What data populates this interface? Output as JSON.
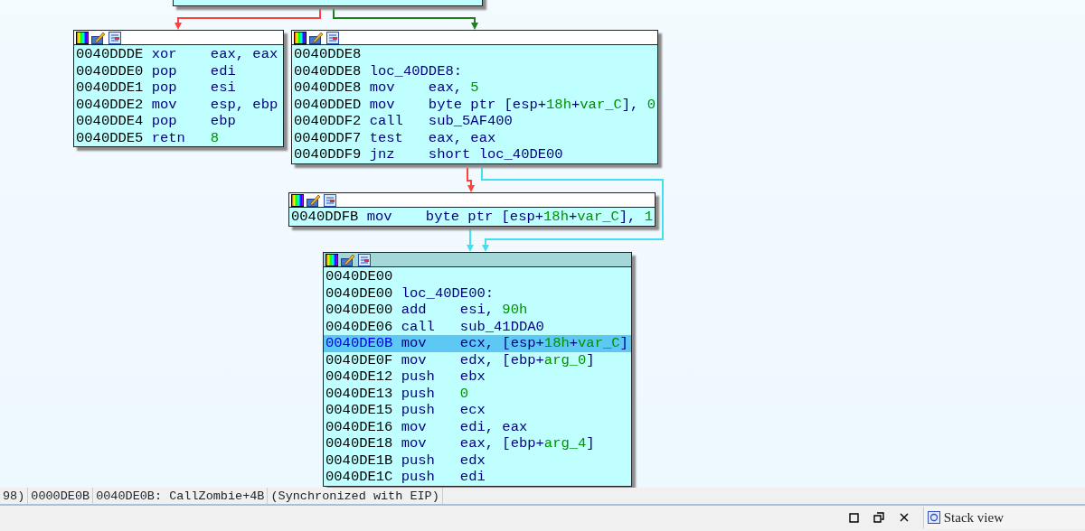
{
  "graph": {
    "edges": [
      {
        "color": "#ff4040"
      },
      {
        "color": "#208020"
      },
      {
        "color": "#ff4040"
      },
      {
        "color": "#40e0f0"
      },
      {
        "color": "#40e0f0"
      }
    ],
    "nodes": [
      {
        "selected": false,
        "lines": [
          {
            "address": "0040DDDE",
            "mnemonic": "xor",
            "operand": [
              {
                "text": "eax, eax",
                "kind": "plain"
              }
            ],
            "selected": false
          },
          {
            "address": "0040DDE0",
            "mnemonic": "pop",
            "operand": [
              {
                "text": "edi",
                "kind": "plain"
              }
            ],
            "selected": false
          },
          {
            "address": "0040DDE1",
            "mnemonic": "pop",
            "operand": [
              {
                "text": "esi",
                "kind": "plain"
              }
            ],
            "selected": false
          },
          {
            "address": "0040DDE2",
            "mnemonic": "mov",
            "operand": [
              {
                "text": "esp, ebp",
                "kind": "plain"
              }
            ],
            "selected": false
          },
          {
            "address": "0040DDE4",
            "mnemonic": "pop",
            "operand": [
              {
                "text": "ebp",
                "kind": "plain"
              }
            ],
            "selected": false
          },
          {
            "address": "0040DDE5",
            "mnemonic": "retn",
            "operand": [
              {
                "text": "8",
                "kind": "const"
              }
            ],
            "selected": false
          }
        ]
      },
      {
        "selected": false,
        "lines": [
          {
            "address": "0040DDE8",
            "selected": false
          },
          {
            "address": "0040DDE8",
            "label": "loc_40DDE8:",
            "selected": false
          },
          {
            "address": "0040DDE8",
            "mnemonic": "mov",
            "operand": [
              {
                "text": "eax, ",
                "kind": "plain"
              },
              {
                "text": "5",
                "kind": "const"
              }
            ],
            "selected": false
          },
          {
            "address": "0040DDED",
            "mnemonic": "mov",
            "operand": [
              {
                "text": "byte ptr [esp+",
                "kind": "plain"
              },
              {
                "text": "18h",
                "kind": "const"
              },
              {
                "text": "+",
                "kind": "plain"
              },
              {
                "text": "var_C",
                "kind": "const"
              },
              {
                "text": "], ",
                "kind": "plain"
              },
              {
                "text": "0",
                "kind": "const"
              }
            ],
            "selected": false
          },
          {
            "address": "0040DDF2",
            "mnemonic": "call",
            "operand": [
              {
                "text": "sub_5AF400",
                "kind": "plain"
              }
            ],
            "selected": false
          },
          {
            "address": "0040DDF7",
            "mnemonic": "test",
            "operand": [
              {
                "text": "eax, eax",
                "kind": "plain"
              }
            ],
            "selected": false
          },
          {
            "address": "0040DDF9",
            "mnemonic": "jnz",
            "operand": [
              {
                "text": "short loc_40DE00",
                "kind": "plain"
              }
            ],
            "selected": false
          }
        ]
      },
      {
        "selected": false,
        "lines": [
          {
            "address": "0040DDFB",
            "mnemonic": "mov",
            "operand": [
              {
                "text": "byte ptr [esp+",
                "kind": "plain"
              },
              {
                "text": "18h",
                "kind": "const"
              },
              {
                "text": "+",
                "kind": "plain"
              },
              {
                "text": "var_C",
                "kind": "const"
              },
              {
                "text": "], ",
                "kind": "plain"
              },
              {
                "text": "1",
                "kind": "const"
              }
            ],
            "selected": false
          }
        ]
      },
      {
        "selected": true,
        "lines": [
          {
            "address": "0040DE00",
            "selected": false
          },
          {
            "address": "0040DE00",
            "label": "loc_40DE00:",
            "selected": false
          },
          {
            "address": "0040DE00",
            "mnemonic": "add",
            "operand": [
              {
                "text": "esi, ",
                "kind": "plain"
              },
              {
                "text": "90h",
                "kind": "const"
              }
            ],
            "selected": false
          },
          {
            "address": "0040DE06",
            "mnemonic": "call",
            "operand": [
              {
                "text": "sub_41DDA0",
                "kind": "plain"
              }
            ],
            "selected": false
          },
          {
            "address": "0040DE0B",
            "mnemonic": "mov",
            "operand": [
              {
                "text": "ecx, [esp+",
                "kind": "plain"
              },
              {
                "text": "18h",
                "kind": "const"
              },
              {
                "text": "+",
                "kind": "plain"
              },
              {
                "text": "var_C",
                "kind": "const"
              },
              {
                "text": "]",
                "kind": "plain"
              }
            ],
            "selected": true
          },
          {
            "address": "0040DE0F",
            "mnemonic": "mov",
            "operand": [
              {
                "text": "edx, [ebp+",
                "kind": "plain"
              },
              {
                "text": "arg_0",
                "kind": "const"
              },
              {
                "text": "]",
                "kind": "plain"
              }
            ],
            "selected": false
          },
          {
            "address": "0040DE12",
            "mnemonic": "push",
            "operand": [
              {
                "text": "ebx",
                "kind": "plain"
              }
            ],
            "selected": false
          },
          {
            "address": "0040DE13",
            "mnemonic": "push",
            "operand": [
              {
                "text": "0",
                "kind": "const"
              }
            ],
            "selected": false
          },
          {
            "address": "0040DE15",
            "mnemonic": "push",
            "operand": [
              {
                "text": "ecx",
                "kind": "plain"
              }
            ],
            "selected": false
          },
          {
            "address": "0040DE16",
            "mnemonic": "mov",
            "operand": [
              {
                "text": "edi, eax",
                "kind": "plain"
              }
            ],
            "selected": false
          },
          {
            "address": "0040DE18",
            "mnemonic": "mov",
            "operand": [
              {
                "text": "eax, [ebp+",
                "kind": "plain"
              },
              {
                "text": "arg_4",
                "kind": "const"
              },
              {
                "text": "]",
                "kind": "plain"
              }
            ],
            "selected": false
          },
          {
            "address": "0040DE1B",
            "mnemonic": "push",
            "operand": [
              {
                "text": "edx",
                "kind": "plain"
              }
            ],
            "selected": false
          },
          {
            "address": "0040DE1C",
            "mnemonic": "push",
            "operand": [
              {
                "text": "edi",
                "kind": "plain"
              }
            ],
            "selected": false
          }
        ]
      }
    ]
  },
  "status_bar": [
    "98)",
    "0000DE0B",
    "0040DE0B: CallZombie+4B",
    "(Synchronized with EIP)"
  ],
  "bottom_panel": {
    "tab": "Stack view"
  }
}
